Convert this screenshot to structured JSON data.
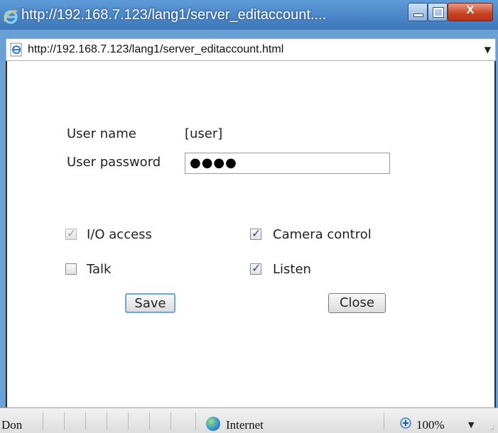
{
  "window": {
    "title": "http://192.168.7.123/lang1/server_editaccount....",
    "minimize_glyph": "−",
    "close_glyph": "X",
    "address": "http://192.168.7.123/lang1/server_editaccount.html"
  },
  "form": {
    "user_name_label": "User name",
    "user_name_value": "[user]",
    "password_label": "User password",
    "password_value": "●●●●",
    "permissions": {
      "io_access": {
        "label": "I/O access",
        "checked": true,
        "disabled": true
      },
      "camera_control": {
        "label": "Camera control",
        "checked": true,
        "disabled": false
      },
      "talk": {
        "label": "Talk",
        "checked": false,
        "disabled": false
      },
      "listen": {
        "label": "Listen",
        "checked": true,
        "disabled": false
      }
    },
    "save_label": "Save",
    "close_label": "Close",
    "check_glyph": "✓"
  },
  "status": {
    "text": "Don",
    "zone": "Internet",
    "zoom": "100%",
    "dropdown_glyph": "▼"
  },
  "colors": {
    "titlebar": "#4b86c8",
    "close_button": "#c8421f",
    "check": "#2a4a9a"
  },
  "icons": {
    "title": "ie-logo-icon",
    "address": "ie-page-icon",
    "zone": "globe-icon",
    "zoom": "zoom-icon"
  }
}
